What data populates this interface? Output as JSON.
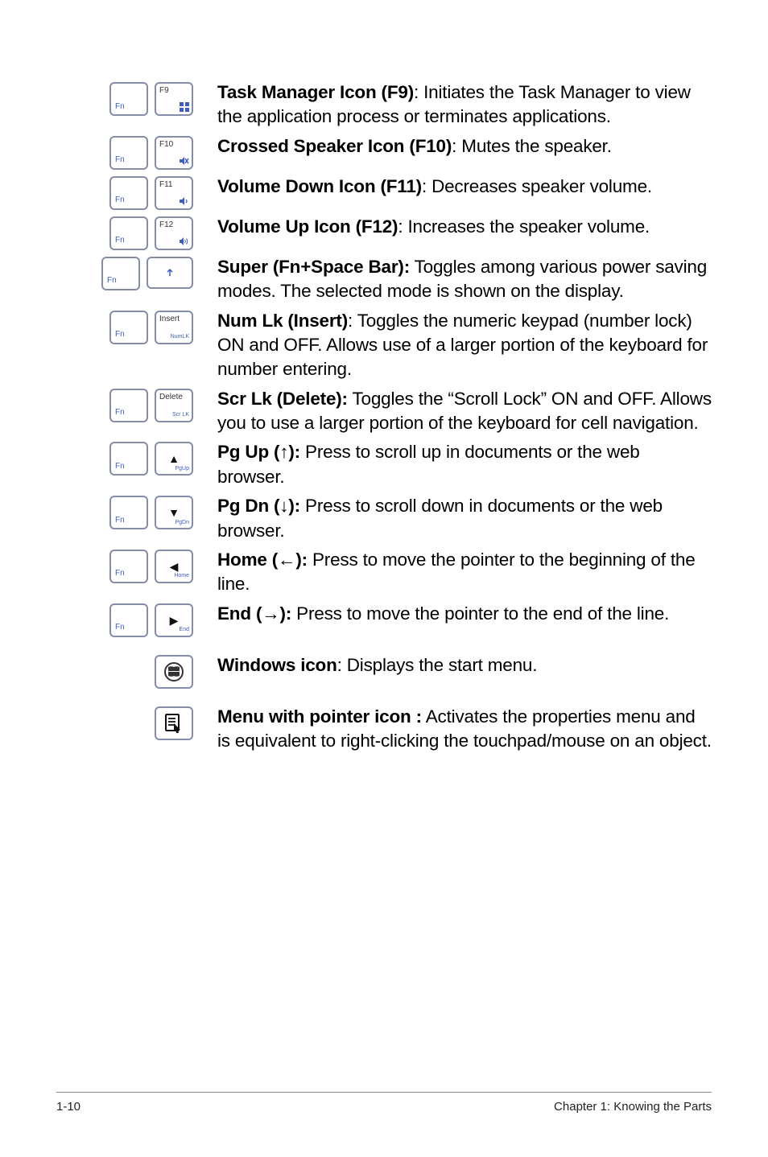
{
  "items": [
    {
      "keys": {
        "type": "fn-pair",
        "main": "F9",
        "subIcon": "grid"
      },
      "title": "Task Manager Icon (F9)",
      "desc": ": Initiates the Task Manager to view the application process or terminates applications."
    },
    {
      "keys": {
        "type": "fn-pair",
        "main": "F10",
        "subIcon": "mute"
      },
      "title": "Crossed Speaker Icon (F10)",
      "desc": ": Mutes the speaker."
    },
    {
      "keys": {
        "type": "fn-pair",
        "main": "F11",
        "subIcon": "vol-down"
      },
      "title": "Volume Down Icon (F11)",
      "desc": ": Decreases speaker volume."
    },
    {
      "keys": {
        "type": "fn-pair",
        "main": "F12",
        "subIcon": "vol-up"
      },
      "title": "Volume Up Icon (F12)",
      "desc": ": Increases the speaker volume."
    },
    {
      "keys": {
        "type": "fn-space"
      },
      "title": "Super (Fn+Space Bar):",
      "desc": " Toggles among various power saving modes. The selected mode is shown on the display."
    },
    {
      "keys": {
        "type": "fn-pair",
        "main": "Insert",
        "sub": "NumLK"
      },
      "title": "Num Lk (Insert)",
      "desc": ": Toggles the numeric keypad (number lock) ON and OFF. Allows use of a larger portion of the keyboard for number entering."
    },
    {
      "keys": {
        "type": "fn-pair",
        "main": "Delete",
        "sub": "Scr LK"
      },
      "title": "Scr Lk (Delete):",
      "desc": " Toggles the “Scroll Lock” ON and OFF. Allows you to use a larger portion of the keyboard for cell navigation."
    },
    {
      "keys": {
        "type": "fn-arrow",
        "glyph": "▲",
        "sub": "PgUp"
      },
      "title": "Pg Up (↑):",
      "desc": " Press to scroll up in documents or the web browser."
    },
    {
      "keys": {
        "type": "fn-arrow",
        "glyph": "▼",
        "sub": "PgDn"
      },
      "title": "Pg Dn (↓):",
      "desc": " Press to scroll down in documents or the web browser."
    },
    {
      "keys": {
        "type": "fn-arrow",
        "glyph": "◀",
        "sub": "Home"
      },
      "title": "Home (←):",
      "desc": " Press to move the pointer to the beginning of the line."
    },
    {
      "keys": {
        "type": "fn-arrow",
        "glyph": "▶",
        "sub": "End"
      },
      "title": "End (→):",
      "desc": " Press to move the pointer to the end of the line."
    },
    {
      "keys": {
        "type": "single",
        "icon": "windows"
      },
      "title": "Windows icon",
      "desc": ": Displays the start menu."
    },
    {
      "keys": {
        "type": "single",
        "icon": "menu"
      },
      "title": "Menu with pointer icon :",
      "desc": " Activates the properties menu and is equivalent to right-clicking the touchpad/mouse on an object."
    }
  ],
  "footer": {
    "left": "1-10",
    "right": "Chapter 1: Knowing the Parts"
  },
  "labels": {
    "fn": "Fn"
  }
}
